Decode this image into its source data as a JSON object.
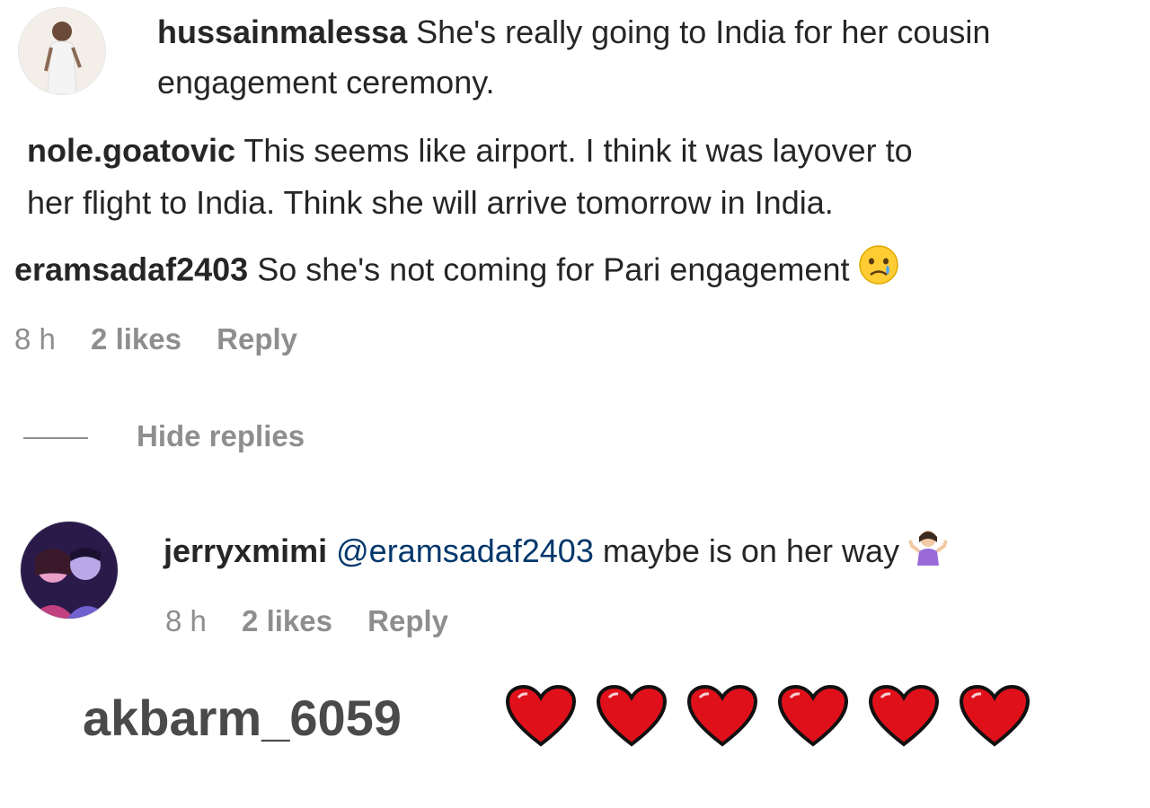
{
  "comments": [
    {
      "username": "hussainmalessa",
      "text_line1": "She's really going to India for her cousin",
      "text_line2": "engagement ceremony."
    },
    {
      "username": "nole.goatovic",
      "text_line1": "This seems like airport. I think it was layover to",
      "text_line2": "her flight to India. Think she will arrive tomorrow in India."
    },
    {
      "username": "eramsadaf2403",
      "text": "So she's not coming for Pari engagement",
      "emoji": "crying-face",
      "time": "8 h",
      "likes": "2 likes",
      "reply_label": "Reply"
    }
  ],
  "hide_replies_label": "Hide replies",
  "reply": {
    "username": "jerryxmimi",
    "mention": "@eramsadaf2403",
    "text": "maybe is on her way",
    "emoji": "woman-shrugging",
    "time": "8 h",
    "likes": "2 likes",
    "reply_label": "Reply"
  },
  "bottom_comment": {
    "username": "akbarm_6059",
    "hearts": [
      "red-heart",
      "red-heart",
      "red-heart",
      "red-heart",
      "red-heart",
      "red-heart"
    ]
  },
  "colors": {
    "text": "#262626",
    "meta": "#8e8e8e",
    "mention": "#00376b",
    "heart": "#e0101b"
  }
}
